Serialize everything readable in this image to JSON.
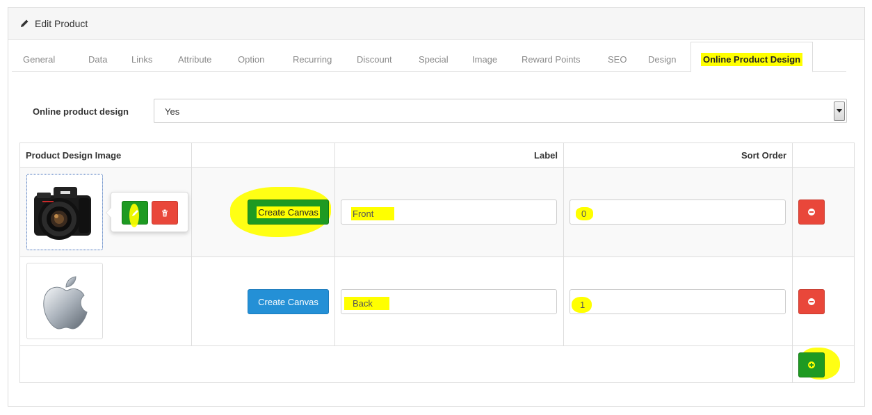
{
  "panel": {
    "title": "Edit Product",
    "title_icon": "pencil-icon"
  },
  "tabs": [
    {
      "label": "General"
    },
    {
      "label": "Data"
    },
    {
      "label": "Links"
    },
    {
      "label": "Attribute"
    },
    {
      "label": "Option"
    },
    {
      "label": "Recurring"
    },
    {
      "label": "Discount"
    },
    {
      "label": "Special"
    },
    {
      "label": "Image"
    },
    {
      "label": "Reward Points"
    },
    {
      "label": "SEO"
    },
    {
      "label": "Design"
    },
    {
      "label": "Online Product Design",
      "active": true
    }
  ],
  "form": {
    "online_design_label": "Online product design",
    "online_design_value": "Yes"
  },
  "table": {
    "headers": {
      "image": "Product Design Image",
      "blank": "",
      "label": "Label",
      "sort": "Sort Order"
    },
    "rows": [
      {
        "image_icon": "camera-image",
        "create_canvas_label": "Create Canvas",
        "label_value": "Front",
        "sort_value": "0",
        "edit_icon": "pencil-icon",
        "delete_icon": "trash-icon",
        "remove_icon": "minus-circle-icon"
      },
      {
        "image_icon": "apple-logo-image",
        "create_canvas_label": "Create Canvas",
        "label_value": "Back",
        "sort_value": "1",
        "remove_icon": "minus-circle-icon"
      }
    ],
    "add_icon": "plus-circle-icon"
  },
  "colors": {
    "highlight": "#ffff00",
    "green_button": "#1e9a22",
    "red_button": "#e9473a",
    "blue_button": "#2490d6"
  }
}
